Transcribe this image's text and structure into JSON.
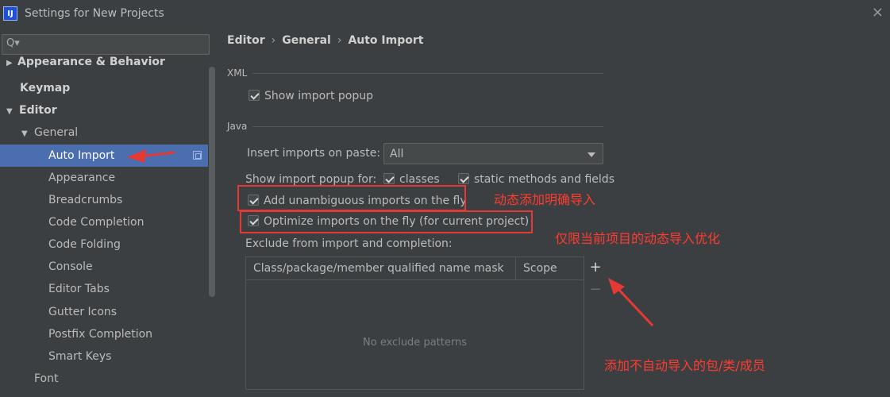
{
  "window": {
    "icon_text": "IJ",
    "title": "Settings for New Projects",
    "close_glyph": "×"
  },
  "search": {
    "icon": "search-icon",
    "glyph": "Q▾",
    "placeholder": ""
  },
  "tree": {
    "items": [
      {
        "label": "Appearance & Behavior",
        "arrow": "▶"
      },
      {
        "label": "Keymap",
        "arrow": ""
      },
      {
        "label": "Editor",
        "arrow": "▼"
      },
      {
        "label": "General",
        "arrow": "▼"
      },
      {
        "label": "Auto Import",
        "arrow": ""
      },
      {
        "label": "Appearance",
        "arrow": ""
      },
      {
        "label": "Breadcrumbs",
        "arrow": ""
      },
      {
        "label": "Code Completion",
        "arrow": ""
      },
      {
        "label": "Code Folding",
        "arrow": ""
      },
      {
        "label": "Console",
        "arrow": ""
      },
      {
        "label": "Editor Tabs",
        "arrow": ""
      },
      {
        "label": "Gutter Icons",
        "arrow": ""
      },
      {
        "label": "Postfix Completion",
        "arrow": ""
      },
      {
        "label": "Smart Keys",
        "arrow": ""
      },
      {
        "label": "Font",
        "arrow": ""
      }
    ]
  },
  "breadcrumb": {
    "items": [
      "Editor",
      "General",
      "Auto Import"
    ],
    "separator": "›"
  },
  "xml": {
    "section_label": "XML",
    "show_import_popup": {
      "label": "Show import popup",
      "checked": true
    }
  },
  "java": {
    "section_label": "Java",
    "insert_imports_label": "Insert imports on paste:",
    "insert_imports_value": "All",
    "show_popup_for_label": "Show import popup for:",
    "classes": {
      "label": "classes",
      "checked": true
    },
    "static_methods": {
      "label": "static methods and fields",
      "checked": true
    },
    "add_unambiguous": {
      "label": "Add unambiguous imports on the fly",
      "checked": true
    },
    "optimize_imports": {
      "label": "Optimize imports on the fly (for current project)",
      "checked": true
    },
    "exclude_label": "Exclude from import and completion:"
  },
  "exclude_table": {
    "columns": [
      "Class/package/member qualified name mask",
      "Scope"
    ],
    "empty_text": "No exclude patterns",
    "add_glyph": "+",
    "remove_glyph": "−"
  },
  "annotations": {
    "auto_import_note": "",
    "add_unambiguous_note": "动态添加明确导入",
    "optimize_note": "仅限当前项目的动态导入优化",
    "exclude_note": "添加不自动导入的包/类/成员",
    "color": "#e53935"
  },
  "colors": {
    "background": "#3c3f41",
    "selection": "#4b6eaf",
    "text": "#bbbbbb"
  }
}
